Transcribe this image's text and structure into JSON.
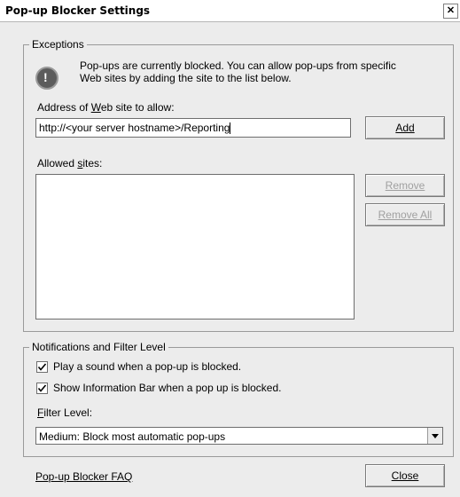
{
  "window": {
    "title": "Pop-up Blocker Settings",
    "close_icon": "close-icon"
  },
  "exceptions": {
    "legend": "Exceptions",
    "info_line1": "Pop-ups are currently blocked.  You can allow pop-ups from specific",
    "info_line2": "Web sites by adding the site to the list below.",
    "address_label_pre": "Address of ",
    "address_label_u": "W",
    "address_label_post": "eb site to allow:",
    "address_value": "http://<your server hostname>/Reporting",
    "add_button_label": "Add",
    "allowed_label_pre": "Allowed ",
    "allowed_label_u": "s",
    "allowed_label_post": "ites:",
    "allowed_sites": [],
    "remove_button_label": "Remove",
    "remove_all_button_label": "Remove All"
  },
  "notifications": {
    "legend": "Notifications and Filter Level",
    "play_sound_label": "Play a sound when a pop-up is blocked.",
    "play_sound_checked": true,
    "show_info_bar_label": "Show Information Bar when a pop up is blocked.",
    "show_info_bar_checked": true,
    "filter_level_label_u": "F",
    "filter_level_label_post": "ilter Level:",
    "filter_level_value": "Medium: Block most automatic pop-ups"
  },
  "footer": {
    "faq_link": "Pop-up Blocker FAQ",
    "close_button_label": "Close"
  }
}
